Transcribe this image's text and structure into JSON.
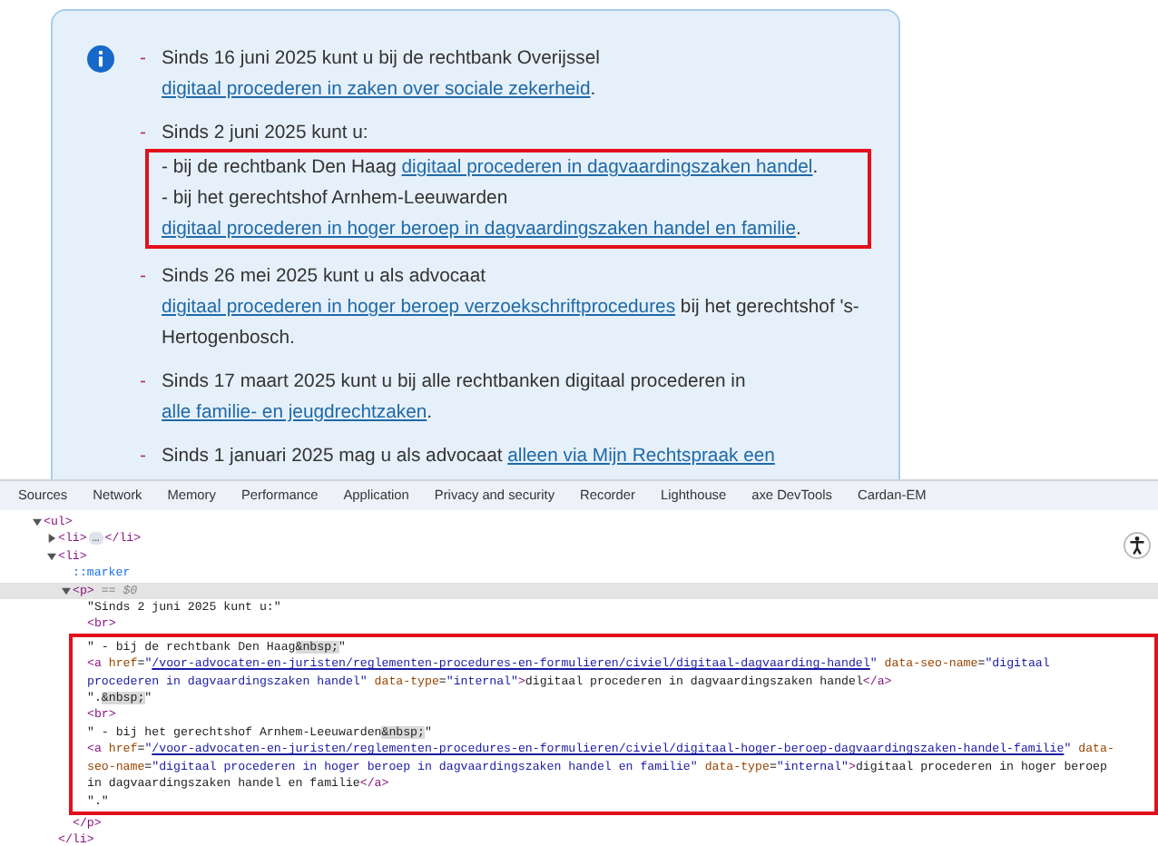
{
  "notice": {
    "items": [
      {
        "bullet": "-",
        "lines": [
          {
            "highlighted": false,
            "parts": [
              {
                "kind": "text",
                "text": "Sinds 16 juni 2025 kunt u bij de rechtbank Overijssel "
              },
              {
                "kind": "link",
                "text": "digitaal procederen in zaken over sociale zekerheid"
              },
              {
                "kind": "text",
                "text": "."
              }
            ]
          }
        ]
      },
      {
        "bullet": "-",
        "lines": [
          {
            "highlighted": false,
            "parts": [
              {
                "kind": "text",
                "text": "Sinds 2 juni 2025 kunt u:"
              }
            ]
          },
          {
            "highlighted": true,
            "parts": [
              {
                "kind": "text",
                "text": "- bij de rechtbank Den Haag "
              },
              {
                "kind": "link",
                "text": "digitaal procederen in dagvaardingszaken handel"
              },
              {
                "kind": "text",
                "text": "."
              }
            ]
          },
          {
            "highlighted": true,
            "parts": [
              {
                "kind": "text",
                "text": "- bij het gerechtshof Arnhem-Leeuwarden "
              },
              {
                "kind": "link",
                "text": "digitaal procederen in hoger beroep in dagvaardingszaken handel en familie"
              },
              {
                "kind": "text",
                "text": "."
              }
            ]
          }
        ]
      },
      {
        "bullet": "-",
        "lines": [
          {
            "highlighted": false,
            "parts": [
              {
                "kind": "text",
                "text": "Sinds 26 mei 2025 kunt u als advocaat "
              },
              {
                "kind": "link",
                "text": "digitaal procederen in hoger beroep verzoekschriftprocedures"
              },
              {
                "kind": "text",
                "text": " bij het gerechtshof 's-Hertogenbosch."
              }
            ]
          }
        ]
      },
      {
        "bullet": "-",
        "lines": [
          {
            "highlighted": false,
            "parts": [
              {
                "kind": "text",
                "text": "Sinds 17 maart 2025 kunt u bij alle rechtbanken digitaal procederen in "
              },
              {
                "kind": "link",
                "text": "alle familie- en jeugdrechtzaken"
              },
              {
                "kind": "text",
                "text": "."
              }
            ]
          }
        ]
      },
      {
        "bullet": "-",
        "lines": [
          {
            "highlighted": false,
            "parts": [
              {
                "kind": "text",
                "text": "Sinds 1 januari 2025 mag u als advocaat "
              },
              {
                "kind": "link",
                "text": "alleen via Mijn Rechtspraak een"
              }
            ]
          }
        ]
      }
    ]
  },
  "devtools": {
    "tabs": [
      {
        "label": "Sources",
        "selected": false
      },
      {
        "label": "Network",
        "selected": false
      },
      {
        "label": "Memory",
        "selected": false
      },
      {
        "label": "Performance",
        "selected": false
      },
      {
        "label": "Application",
        "selected": false
      },
      {
        "label": "Privacy and security",
        "selected": false
      },
      {
        "label": "Recorder",
        "selected": false
      },
      {
        "label": "Lighthouse",
        "selected": false
      },
      {
        "label": "axe DevTools",
        "selected": false
      },
      {
        "label": "Cardan-EM",
        "selected": false
      }
    ],
    "tree": [
      {
        "expanded": true,
        "selected": false,
        "tokens": [
          {
            "kind": "tag",
            "text": "<ul>"
          }
        ],
        "children": [
          {
            "expanded": false,
            "selected": false,
            "tokens": [
              {
                "kind": "tag",
                "text": "<li>"
              },
              {
                "kind": "ellipsis",
                "text": "…"
              },
              {
                "kind": "tag",
                "text": "</li>"
              }
            ]
          },
          {
            "expanded": true,
            "selected": false,
            "tokens": [
              {
                "kind": "tag",
                "text": "<li>"
              }
            ],
            "closing": [
              {
                "kind": "tag",
                "text": "</li>"
              }
            ],
            "children": [
              {
                "selected": false,
                "tokens": [
                  {
                    "kind": "pseudo",
                    "text": "::marker"
                  }
                ]
              },
              {
                "expanded": true,
                "selected": true,
                "tokens": [
                  {
                    "kind": "tag",
                    "text": "<p>"
                  },
                  {
                    "kind": "note",
                    "text": " == $0"
                  }
                ],
                "closing": [
                  {
                    "kind": "tag",
                    "text": "</p>"
                  }
                ],
                "children": [
                  {
                    "kind": "node",
                    "selected": false,
                    "tokens": [
                      {
                        "kind": "text",
                        "text": "\"Sinds 2 juni 2025 kunt u:\""
                      }
                    ]
                  },
                  {
                    "kind": "node",
                    "selected": false,
                    "tokens": [
                      {
                        "kind": "tag",
                        "text": "<br>"
                      }
                    ]
                  },
                  {
                    "kind": "highlight",
                    "children": [
                      {
                        "selected": false,
                        "tokens": [
                          {
                            "kind": "text",
                            "text": "\" - bij de rechtbank Den Haag"
                          },
                          {
                            "kind": "entity",
                            "text": "&nbsp;"
                          },
                          {
                            "kind": "text",
                            "text": "\""
                          }
                        ]
                      },
                      {
                        "selected": false,
                        "tokens": [
                          {
                            "kind": "tag",
                            "text": "<a"
                          },
                          {
                            "kind": "attr",
                            "text": " href"
                          },
                          {
                            "kind": "text",
                            "text": "="
                          },
                          {
                            "kind": "value",
                            "text": "\""
                          },
                          {
                            "kind": "link",
                            "text": "/voor-advocaten-en-juristen/reglementen-procedures-en-formulieren/civiel/digitaal-dagvaarding-handel"
                          },
                          {
                            "kind": "value",
                            "text": "\""
                          },
                          {
                            "kind": "attr",
                            "text": " data-seo-name"
                          },
                          {
                            "kind": "text",
                            "text": "="
                          },
                          {
                            "kind": "value",
                            "text": "\"digitaal procederen in dagvaardingszaken handel\""
                          },
                          {
                            "kind": "attr",
                            "text": " data-type"
                          },
                          {
                            "kind": "text",
                            "text": "="
                          },
                          {
                            "kind": "value",
                            "text": "\"internal\""
                          },
                          {
                            "kind": "tag",
                            "text": ">"
                          },
                          {
                            "kind": "text",
                            "text": "digitaal procederen in dagvaardingszaken handel"
                          },
                          {
                            "kind": "tag",
                            "text": "</a>"
                          }
                        ]
                      },
                      {
                        "selected": false,
                        "tokens": [
                          {
                            "kind": "text",
                            "text": "\"."
                          },
                          {
                            "kind": "entity",
                            "text": "&nbsp;"
                          },
                          {
                            "kind": "text",
                            "text": "\""
                          }
                        ]
                      },
                      {
                        "selected": false,
                        "tokens": [
                          {
                            "kind": "tag",
                            "text": "<br>"
                          }
                        ]
                      },
                      {
                        "selected": false,
                        "tokens": [
                          {
                            "kind": "text",
                            "text": "\" - bij het gerechtshof Arnhem-Leeuwarden"
                          },
                          {
                            "kind": "entity",
                            "text": "&nbsp;"
                          },
                          {
                            "kind": "text",
                            "text": "\""
                          }
                        ]
                      },
                      {
                        "selected": false,
                        "tokens": [
                          {
                            "kind": "tag",
                            "text": "<a"
                          },
                          {
                            "kind": "attr",
                            "text": " href"
                          },
                          {
                            "kind": "text",
                            "text": "="
                          },
                          {
                            "kind": "value",
                            "text": "\""
                          },
                          {
                            "kind": "link",
                            "text": "/voor-advocaten-en-juristen/reglementen-procedures-en-formulieren/civiel/digitaal-hoger-beroep-dagvaardingszaken-handel-familie"
                          },
                          {
                            "kind": "value",
                            "text": "\""
                          },
                          {
                            "kind": "attr",
                            "text": " data-seo-name"
                          },
                          {
                            "kind": "text",
                            "text": "="
                          },
                          {
                            "kind": "value",
                            "text": "\"digitaal procederen in hoger beroep in dagvaardingszaken handel en familie\""
                          },
                          {
                            "kind": "attr",
                            "text": " data-type"
                          },
                          {
                            "kind": "text",
                            "text": "="
                          },
                          {
                            "kind": "value",
                            "text": "\"internal\""
                          },
                          {
                            "kind": "tag",
                            "text": ">"
                          },
                          {
                            "kind": "text",
                            "text": "digitaal procederen in hoger beroep in dagvaardingszaken handel en familie"
                          },
                          {
                            "kind": "tag",
                            "text": "</a>"
                          }
                        ]
                      },
                      {
                        "selected": false,
                        "tokens": [
                          {
                            "kind": "text",
                            "text": "\".\""
                          }
                        ]
                      }
                    ]
                  }
                ]
              }
            ]
          }
        ]
      }
    ]
  }
}
